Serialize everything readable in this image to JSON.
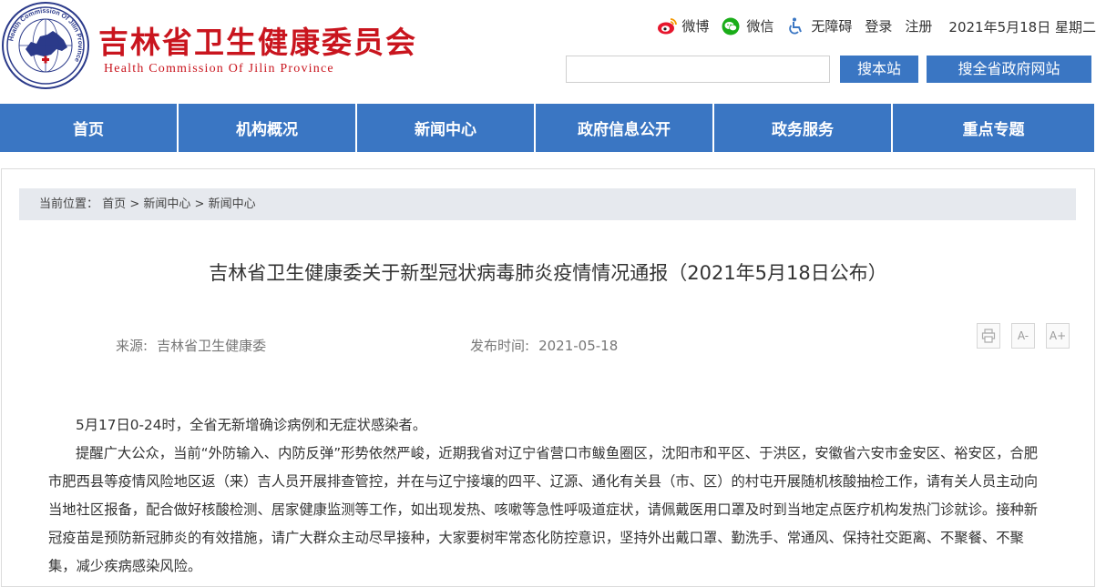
{
  "header": {
    "logo_ring_text": "Health Commission Of Jilin Province",
    "title": "吉林省卫生健康委员会",
    "subtitle": "Health Commission Of Jilin Province",
    "links": {
      "weibo": "微博",
      "wechat": "微信",
      "accessibility": "无障碍",
      "login": "登录",
      "register": "注册"
    },
    "date": "2021年5月18日 星期二",
    "search": {
      "placeholder": "",
      "value": "",
      "site_button": "搜本站",
      "gov_button": "搜全省政府网站"
    },
    "icons": {
      "weibo": "weibo-icon",
      "wechat": "wechat-icon",
      "accessibility": "wheelchair-icon"
    },
    "colors": {
      "brand_red": "#c9151e",
      "nav_blue": "#3a76c3",
      "weibo": "#e6162d",
      "wechat": "#1aad19",
      "accessibility": "#3a76c3"
    }
  },
  "nav": {
    "items": [
      {
        "label": "首页"
      },
      {
        "label": "机构概况"
      },
      {
        "label": "新闻中心"
      },
      {
        "label": "政府信息公开"
      },
      {
        "label": "政务服务"
      },
      {
        "label": "重点专题"
      }
    ]
  },
  "breadcrumb": {
    "prefix": "当前位置：",
    "items": [
      "首页",
      "新闻中心",
      "新闻中心"
    ],
    "separator": ">"
  },
  "article": {
    "title": "吉林省卫生健康委关于新型冠状病毒肺炎疫情情况通报（2021年5月18日公布）",
    "source_label": "来源:",
    "source": "吉林省卫生健康委",
    "date_label": "发布时间:",
    "date": "2021-05-18",
    "tools": {
      "print": "print-icon",
      "font_smaller": "A-",
      "font_larger": "A+"
    },
    "paragraphs": [
      "5月17日0-24时，全省无新增确诊病例和无症状感染者。",
      "提醒广大公众，当前“外防输入、内防反弹”形势依然严峻，近期我省对辽宁省营口市鲅鱼圈区，沈阳市和平区、于洪区，安徽省六安市金安区、裕安区，合肥市肥西县等疫情风险地区返（来）吉人员开展排查管控，并在与辽宁接壤的四平、辽源、通化有关县（市、区）的村屯开展随机核酸抽检工作，请有关人员主动向当地社区报备，配合做好核酸检测、居家健康监测等工作，如出现发热、咳嗽等急性呼吸道症状，请佩戴医用口罩及时到当地定点医疗机构发热门诊就诊。接种新冠疫苗是预防新冠肺炎的有效措施，请广大群众主动尽早接种，大家要树牢常态化防控意识，坚持外出戴口罩、勤洗手、常通风、保持社交距离、不聚餐、不聚集，减少疾病感染风险。"
    ]
  }
}
